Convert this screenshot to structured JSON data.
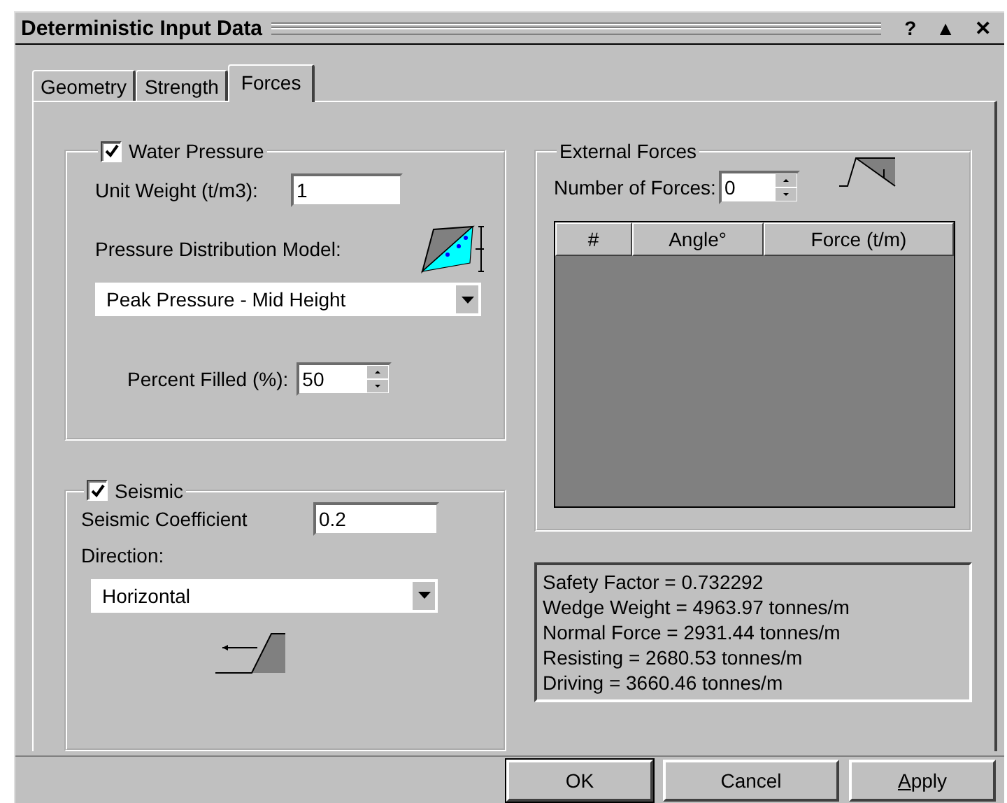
{
  "window": {
    "title": "Deterministic Input Data",
    "controls": [
      "?",
      "▲",
      "✕"
    ]
  },
  "tabs": [
    {
      "label": "Geometry",
      "selected": false
    },
    {
      "label": "Strength",
      "selected": false
    },
    {
      "label": "Forces",
      "selected": true
    }
  ],
  "water_pressure": {
    "label": "Water Pressure",
    "checked": true,
    "unit_weight": {
      "label": "Unit Weight (t/m3):",
      "value": "1"
    },
    "distribution": {
      "label": "Pressure Distribution Model:",
      "value": "Peak Pressure - Mid Height"
    },
    "percent_filled": {
      "label": "Percent Filled (%):",
      "value": "50"
    }
  },
  "seismic": {
    "label": "Seismic",
    "checked": true,
    "coefficient": {
      "label": "Seismic Coefficient",
      "value": "0.2"
    },
    "direction": {
      "label": "Direction:",
      "value": "Horizontal"
    }
  },
  "external_forces": {
    "label": "External Forces",
    "count": {
      "label": "Number of Forces:",
      "value": "0"
    },
    "columns": [
      "#",
      "Angle°",
      "Force (t/m)"
    ]
  },
  "results": [
    "Safety Factor = 0.732292",
    "Wedge Weight = 4963.97 tonnes/m",
    "Normal Force = 2931.44 tonnes/m",
    "Resisting = 2680.53 tonnes/m",
    "Driving = 3660.46 tonnes/m"
  ],
  "buttons": [
    "OK",
    "Cancel",
    "Apply"
  ]
}
